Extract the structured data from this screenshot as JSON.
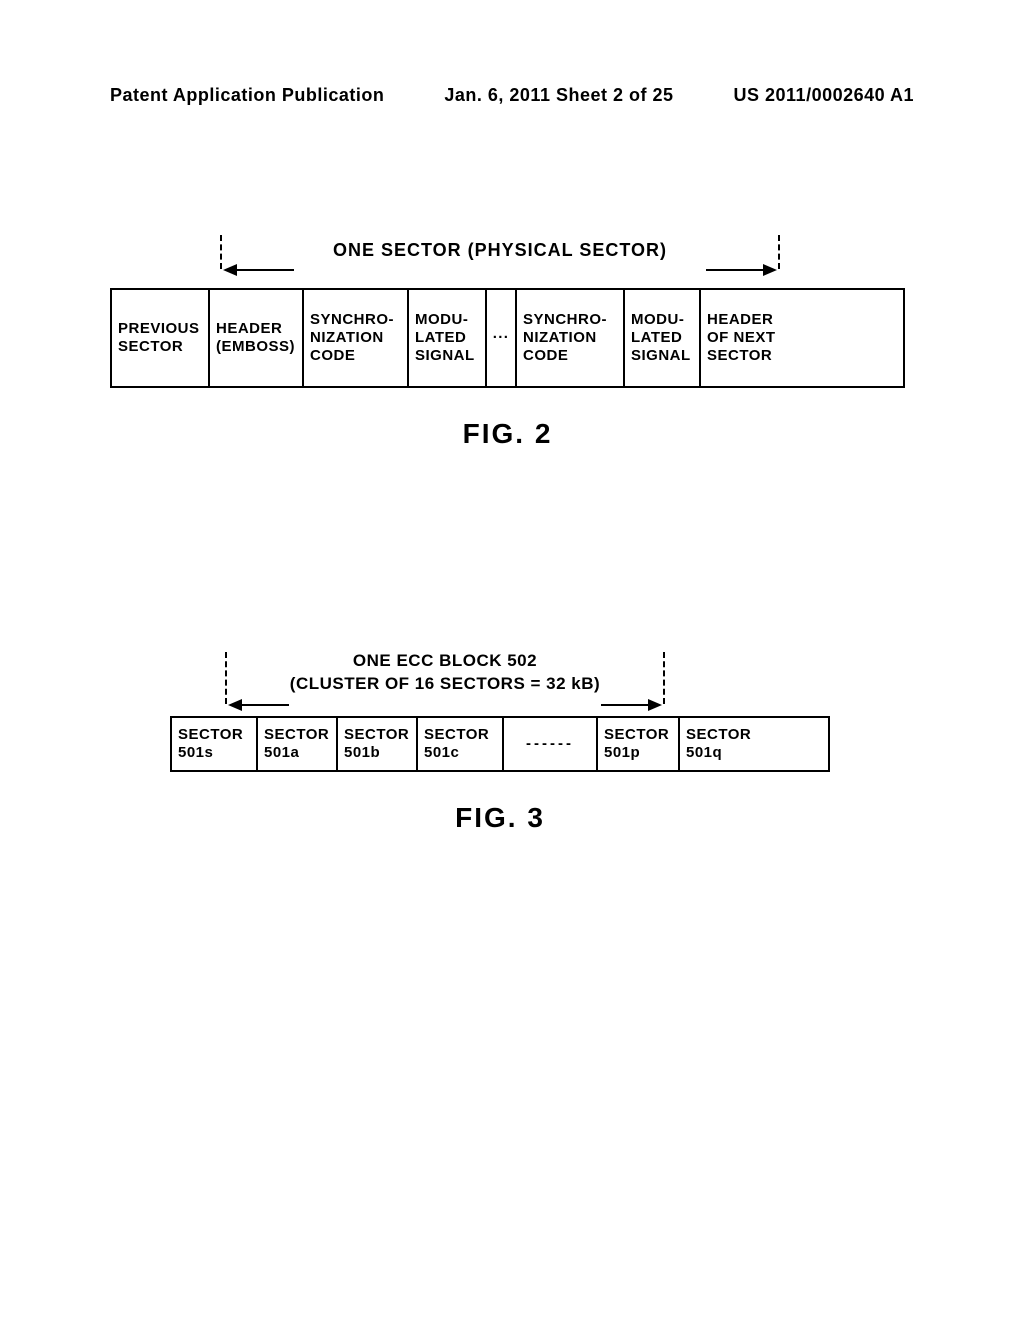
{
  "header": {
    "left": "Patent Application Publication",
    "center": "Jan. 6, 2011  Sheet 2 of 25",
    "right": "US 2011/0002640 A1"
  },
  "fig2": {
    "span_label": "ONE SECTOR (PHYSICAL SECTOR)",
    "cells": {
      "prev": "PREVIOUS SECTOR",
      "header": "HEADER (EMBOSS)",
      "sync": "SYNCHRO-NIZATION CODE",
      "mod": "MODU-LATED SIGNAL",
      "dots": "···",
      "sync2": "SYNCHRO-NIZATION CODE",
      "mod2": "MODU-LATED SIGNAL",
      "next_header": "HEADER OF NEXT SECTOR"
    },
    "label": "FIG. 2"
  },
  "fig3": {
    "ecc_line1": "ONE ECC BLOCK 502",
    "ecc_line2": "(CLUSTER OF 16 SECTORS = 32 kB)",
    "cells": {
      "s501s": "SECTOR 501s",
      "s501a": "SECTOR 501a",
      "s501b": "SECTOR 501b",
      "s501c": "SECTOR 501c",
      "dots": "------",
      "s501p": "SECTOR 501p",
      "s501q": "SECTOR 501q"
    },
    "label": "FIG. 3"
  }
}
